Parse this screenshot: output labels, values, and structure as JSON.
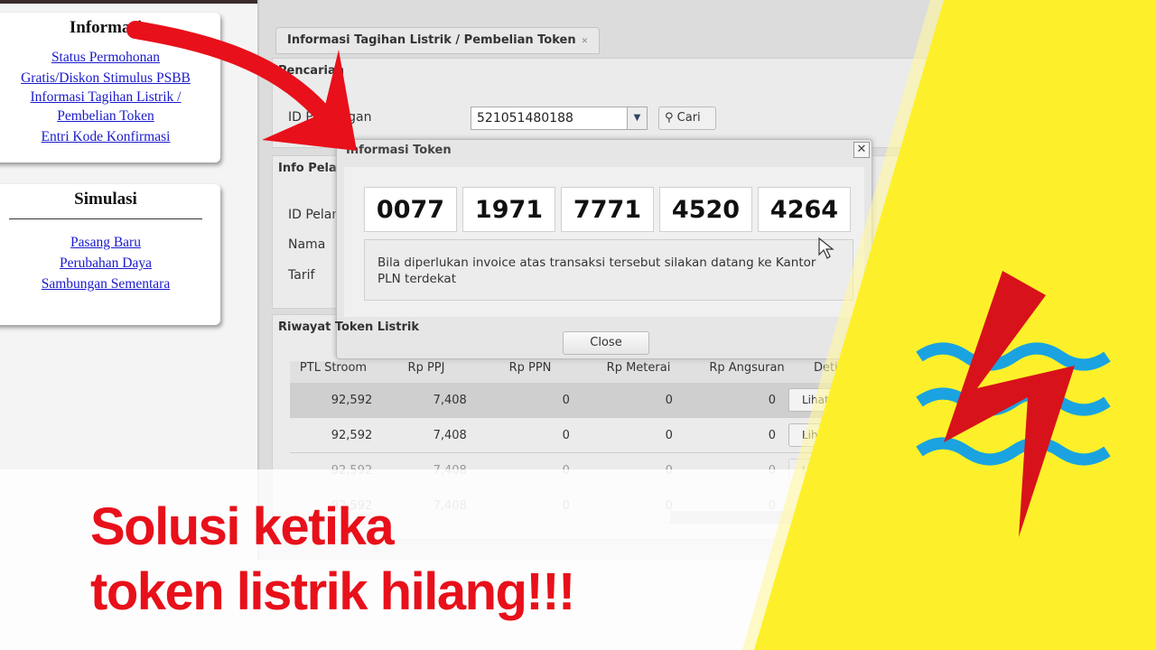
{
  "sidebar": {
    "informasi": {
      "title": "Informasi",
      "links": [
        "Status Permohonan",
        "Gratis/Diskon Stimulus PSBB",
        "Informasi Tagihan Listrik /",
        "Pembelian Token",
        "Entri Kode Konfirmasi"
      ]
    },
    "simulasi": {
      "title": "Simulasi",
      "links": [
        "Pasang Baru",
        "Perubahan Daya",
        "Sambungan Sementara"
      ]
    }
  },
  "app": {
    "tab_label": "Informasi Tagihan Listrik / Pembelian Token",
    "pencarian": {
      "header": "Pencarian",
      "field_label": "ID Pelanggan",
      "field_value": "521051480188",
      "search_button": "Cari"
    },
    "info": {
      "header": "Info Pelanggan",
      "labels": [
        "ID Pelanggan",
        "Nama",
        "Tarif"
      ]
    },
    "riwayat": {
      "header": "Riwayat Token Listrik",
      "columns": [
        "PTL Stroom",
        "Rp PPJ",
        "Rp PPN",
        "Rp Meterai",
        "Rp Angsuran",
        "Detil"
      ],
      "rows": [
        [
          "92,592",
          "7,408",
          "0",
          "0",
          "0",
          "Lihat Token"
        ],
        [
          "92,592",
          "7,408",
          "0",
          "0",
          "0",
          "Lihat Token"
        ],
        [
          "92,592",
          "7,408",
          "0",
          "0",
          "0",
          "Lihat Token"
        ],
        [
          "92,592",
          "7,408",
          "0",
          "0",
          "0",
          "Lihat Token"
        ]
      ]
    }
  },
  "dialog": {
    "title": "Informasi Token",
    "token": [
      "0077",
      "1971",
      "7771",
      "4520",
      "4264"
    ],
    "message": "Bila diperlukan invoice atas transaksi tersebut silakan datang ke Kantor PLN terdekat",
    "close_label": "Close"
  },
  "overlay": {
    "headline_line1": "Solusi ketika",
    "headline_line2": "token listrik hilang!!!"
  },
  "colors": {
    "yellow": "#fdf02a",
    "red": "#e8101a",
    "pln_blue": "#1aa3e0"
  },
  "logo": {
    "name": "PLN logo"
  }
}
